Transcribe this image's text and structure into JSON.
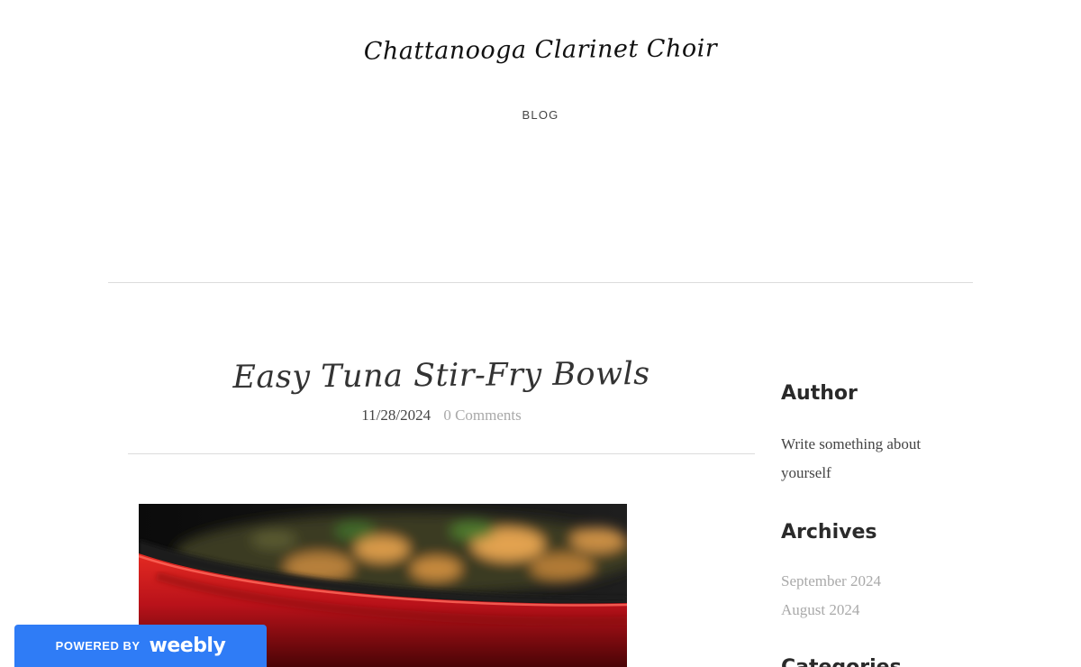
{
  "site": {
    "title": "Chattanooga Clarinet Choir"
  },
  "nav": {
    "items": [
      {
        "label": "BLOG"
      }
    ]
  },
  "post": {
    "title": "Easy Tuna Stir-Fry Bowls",
    "date": "11/28/2024",
    "comments": "0 Comments",
    "image": {
      "subject": "red frying pan with blurred stir-fry"
    }
  },
  "sidebar": {
    "author": {
      "heading": "Author",
      "text": "Write something about yourself"
    },
    "archives": {
      "heading": "Archives",
      "links": [
        "September 2024",
        "August 2024"
      ]
    },
    "categories": {
      "heading": "Categories"
    }
  },
  "badge": {
    "powered_by": "POWERED BY",
    "brand": "weebly",
    "color": "#2f7cf6"
  },
  "colors": {
    "text": "#333333",
    "muted": "#a9a9a9",
    "rule": "#dcdcdc",
    "pan_red": "#c4141a"
  }
}
